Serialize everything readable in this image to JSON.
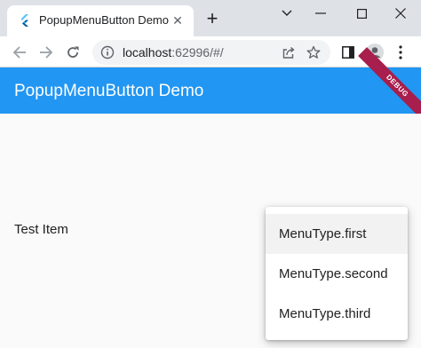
{
  "browser": {
    "tab_title": "PopupMenuButton Demo",
    "url_host": "localhost",
    "url_rest": ":62996/#/"
  },
  "icons": {
    "favicon": "flutter-icon",
    "back": "back-arrow-icon",
    "forward": "forward-arrow-icon",
    "reload": "reload-icon",
    "site_info": "info-icon",
    "share": "share-icon",
    "bookmark": "star-icon",
    "side_panel": "side-panel-icon",
    "profile": "profile-avatar-icon",
    "menu": "kebab-menu-icon"
  },
  "app": {
    "title": "PopupMenuButton Demo",
    "debug_banner": "DEBUG",
    "body_item": "Test Item"
  },
  "popup_menu": {
    "items": [
      {
        "label": "MenuType.first",
        "highlighted": true
      },
      {
        "label": "MenuType.second",
        "highlighted": false
      },
      {
        "label": "MenuType.third",
        "highlighted": false
      }
    ]
  },
  "colors": {
    "app_bar": "#2196f3",
    "debug_banner": "#a81e4c",
    "tab_strip": "#dee1e6"
  }
}
